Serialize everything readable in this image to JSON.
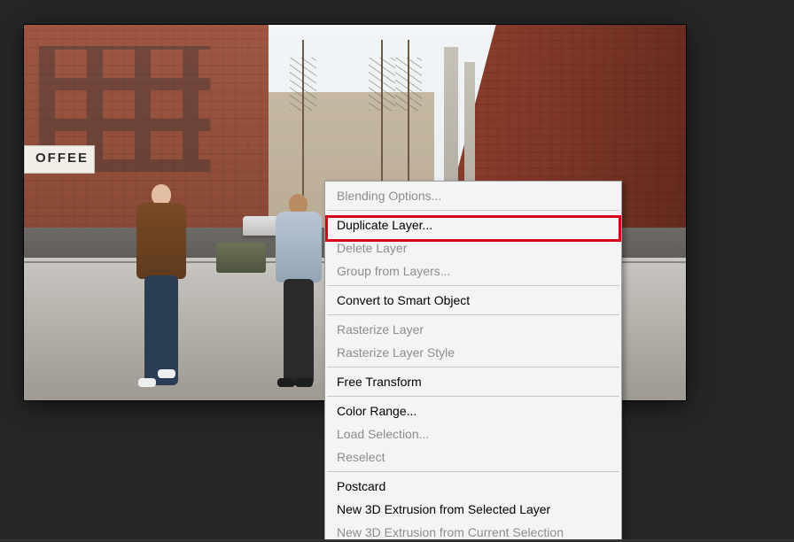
{
  "scene": {
    "coffee_sign": "OFFEE"
  },
  "menu": {
    "blending_options": "Blending Options...",
    "duplicate_layer": "Duplicate Layer...",
    "delete_layer": "Delete Layer",
    "group_from_layers": "Group from Layers...",
    "convert_smart_object": "Convert to Smart Object",
    "rasterize_layer": "Rasterize Layer",
    "rasterize_layer_style": "Rasterize Layer Style",
    "free_transform": "Free Transform",
    "color_range": "Color Range...",
    "load_selection": "Load Selection...",
    "reselect": "Reselect",
    "postcard": "Postcard",
    "new_3d_selected": "New 3D Extrusion from Selected Layer",
    "new_3d_current": "New 3D Extrusion from Current Selection"
  }
}
